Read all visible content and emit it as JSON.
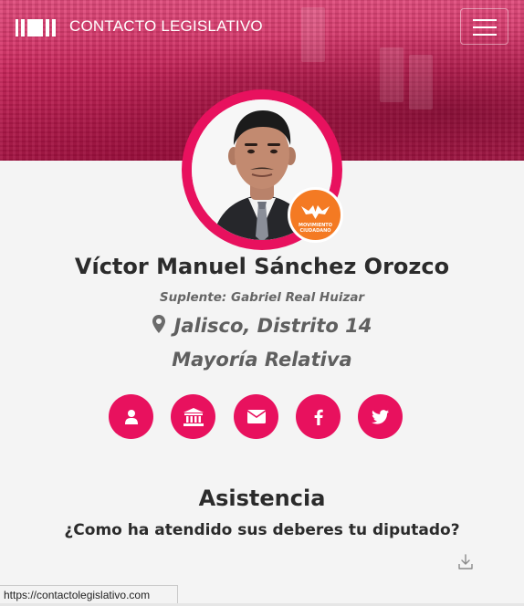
{
  "header": {
    "brand_title": "CONTACTO LEGISLATIVO",
    "brand_icon": "columns-logo-icon",
    "menu_icon": "hamburger-icon"
  },
  "profile": {
    "name": "Víctor Manuel Sánchez Orozco",
    "suplente": "Suplente: Gabriel Real Huizar",
    "district": "Jalisco, Distrito 14",
    "principio": "Mayoría Relativa",
    "party": {
      "badge_text": "MOVIMIENTO CIUDADANO",
      "color": "#f47a23"
    }
  },
  "social": [
    {
      "name": "profile",
      "icon": "user-icon"
    },
    {
      "name": "congress",
      "icon": "institution-icon"
    },
    {
      "name": "email",
      "icon": "envelope-icon"
    },
    {
      "name": "facebook",
      "icon": "facebook-icon"
    },
    {
      "name": "twitter",
      "icon": "twitter-icon"
    }
  ],
  "attendance": {
    "title": "Asistencia",
    "subtitle": "¿Como ha atendido sus deberes tu diputado?"
  },
  "status_bar": {
    "url": "https://contactolegislativo.com"
  },
  "colors": {
    "accent": "#e8115e",
    "hero": "#d1285f"
  }
}
